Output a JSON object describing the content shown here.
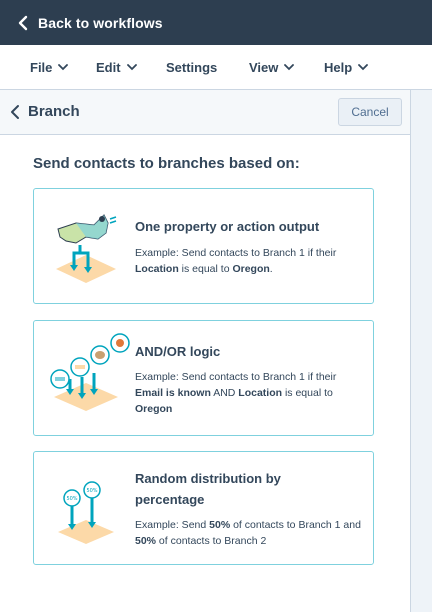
{
  "topbar": {
    "back_label": "Back to workflows"
  },
  "menu": [
    {
      "label": "File"
    },
    {
      "label": "Edit"
    },
    {
      "label": "Settings"
    },
    {
      "label": "View"
    },
    {
      "label": "Help"
    }
  ],
  "panel": {
    "title": "Branch",
    "cancel_label": "Cancel",
    "section_title": "Send contacts to branches based on:"
  },
  "options": [
    {
      "title": "One property or action output",
      "desc_parts": [
        "Example: Send contacts to Branch 1 if their ",
        "Location",
        " is equal to ",
        "Oregon",
        "."
      ]
    },
    {
      "title": "AND/OR logic",
      "desc_parts": [
        "Example: Send contacts to Branch 1 if their ",
        "Email is known",
        " AND ",
        "Location",
        " is equal to ",
        "Oregon"
      ]
    },
    {
      "title": "Random distribution by percentage",
      "desc_parts": [
        "Example: Send ",
        "50%",
        " of contacts to Branch 1 and ",
        "50%",
        " of contacts to Branch 2"
      ]
    }
  ],
  "colors": {
    "topbar_bg": "#2d3e50",
    "card_border": "#7fd1de",
    "teal": "#00a4bd",
    "peach": "#fcd9a8"
  },
  "icons": [
    "chevron-left-icon",
    "chevron-down-icon",
    "us-map-icon",
    "branch-arrows-icon",
    "percent-badge-icon"
  ]
}
